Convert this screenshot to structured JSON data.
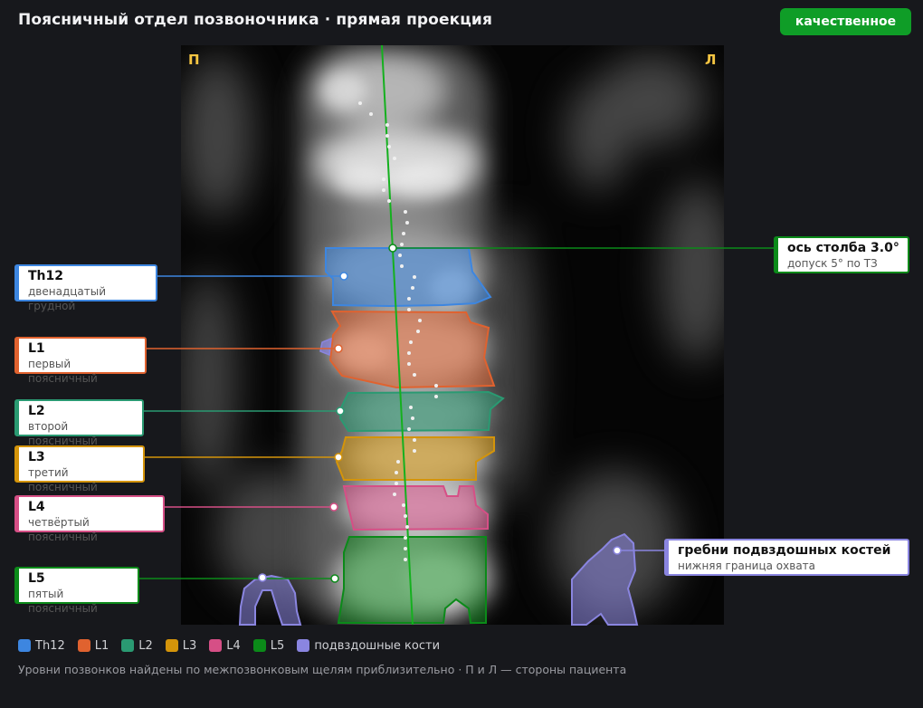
{
  "title": "Поясничный отдел позвоночника · прямая проекция",
  "badge": "качественное",
  "image": {
    "side_left": "П",
    "side_right": "Л"
  },
  "callouts": {
    "th12": {
      "title": "Th12",
      "subtitle": "двенадцатый грудной",
      "color": "#3d86e0"
    },
    "l1": {
      "title": "L1",
      "subtitle": "первый поясничный",
      "color": "#e0622f"
    },
    "l2": {
      "title": "L2",
      "subtitle": "второй поясничный",
      "color": "#2a9a72"
    },
    "l3": {
      "title": "L3",
      "subtitle": "третий поясничный",
      "color": "#d4940a"
    },
    "l4": {
      "title": "L4",
      "subtitle": "четвёртый поясничный",
      "color": "#d64f86"
    },
    "l5": {
      "title": "L5",
      "subtitle": "пятый поясничный",
      "color": "#0b8a19"
    },
    "axis": {
      "title": "ось столба 3.0°",
      "subtitle": "допуск 5° по ТЗ",
      "color": "#0b8a19"
    },
    "iliac": {
      "title": "гребни подвздошных костей",
      "subtitle": "нижняя граница охвата",
      "color": "#8a85e0"
    }
  },
  "legend": [
    {
      "label": "Th12",
      "color": "#3d86e0"
    },
    {
      "label": "L1",
      "color": "#e0622f"
    },
    {
      "label": "L2",
      "color": "#2a9a72"
    },
    {
      "label": "L3",
      "color": "#d4940a"
    },
    {
      "label": "L4",
      "color": "#d64f86"
    },
    {
      "label": "L5",
      "color": "#0b8a19"
    },
    {
      "label": "подвздошные кости",
      "color": "#8a85e0"
    }
  ],
  "note": "Уровни позвонков найдены по межпозвонковым щелям приблизительно · П и Л — стороны пациента"
}
